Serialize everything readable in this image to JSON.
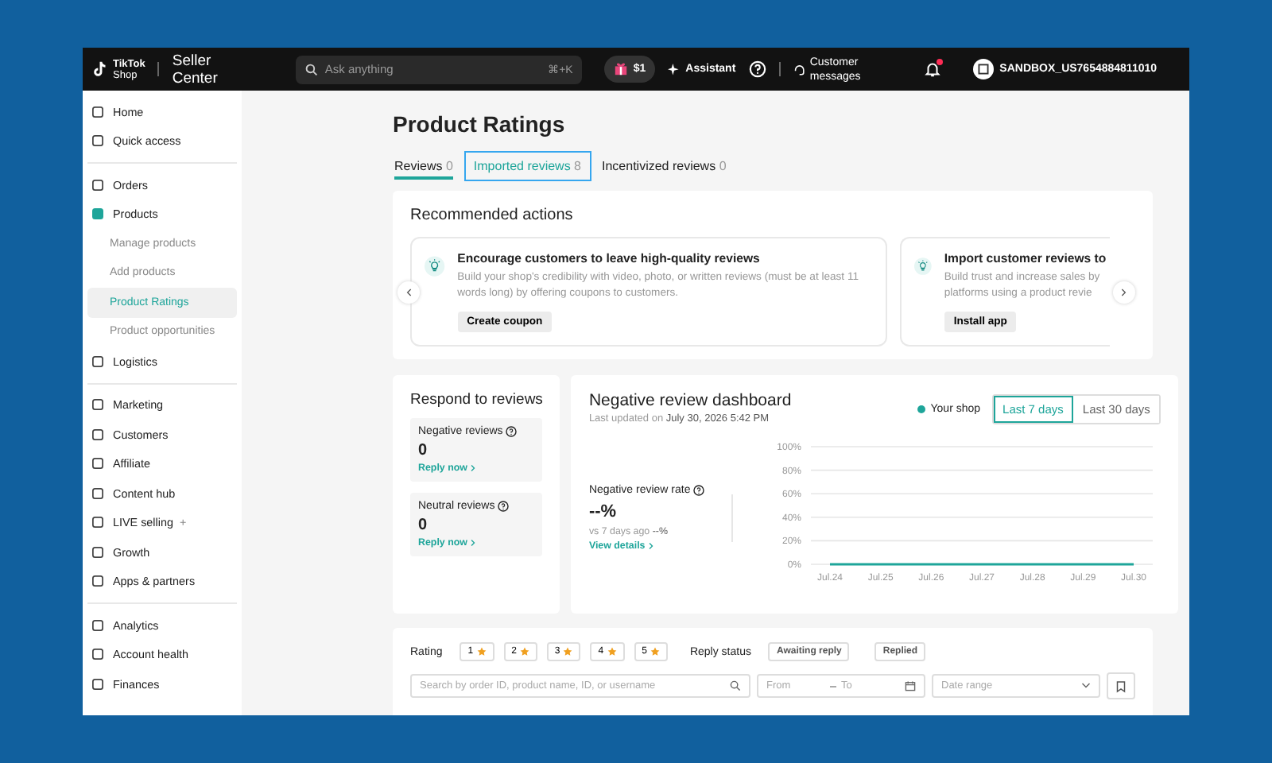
{
  "topbar": {
    "logo": "TikTok",
    "logo_sub": "Shop",
    "product": "Seller Center",
    "search": {
      "placeholder": "Ask anything",
      "shortcut": "⌘+K"
    },
    "gift": "$1",
    "assistant": "Assistant",
    "messages": "Customer messages",
    "notification_dot": true,
    "account": "SANDBOX_US7654884811010"
  },
  "sidebar": {
    "groups": [
      [
        {
          "label": "Home",
          "selected": false
        },
        {
          "label": "Quick access",
          "selected": false
        }
      ],
      [
        {
          "label": "Orders",
          "selected": false
        },
        {
          "label": "Products",
          "selected": false,
          "expanded": true,
          "children": [
            {
              "label": "Manage products",
              "selected": false
            },
            {
              "label": "Add products",
              "selected": false
            },
            {
              "label": "Product Ratings",
              "selected": true
            },
            {
              "label": "Product opportunities",
              "selected": false
            }
          ]
        },
        {
          "label": "Logistics",
          "selected": false
        }
      ],
      [
        {
          "label": "Marketing",
          "selected": false
        },
        {
          "label": "Customers",
          "selected": false
        },
        {
          "label": "Affiliate",
          "selected": false
        },
        {
          "label": "Content hub",
          "selected": false
        },
        {
          "label": "LIVE selling",
          "suffix": "+",
          "selected": false
        },
        {
          "label": "Growth",
          "selected": false
        },
        {
          "label": "Apps & partners",
          "selected": false
        }
      ],
      [
        {
          "label": "Analytics",
          "selected": false
        },
        {
          "label": "Account health",
          "selected": false
        },
        {
          "label": "Finances",
          "selected": false
        }
      ]
    ]
  },
  "page": {
    "title": "Product Ratings",
    "tabs": [
      {
        "label": "Reviews",
        "count": "0",
        "selected": true,
        "focused": false
      },
      {
        "label": "Imported reviews",
        "count": "8",
        "selected": false,
        "focused": true
      },
      {
        "label": "Incentivized reviews",
        "count": "0",
        "selected": false,
        "focused": false
      }
    ],
    "recommended": {
      "title": "Recommended actions",
      "actions": [
        {
          "title": "Encourage customers to leave high-quality reviews",
          "desc": "Build your shop's credibility with video, photo, or written reviews (must be at least 11 words long) by offering coupons to customers.",
          "button": "Create coupon"
        },
        {
          "title": "Import customer reviews to",
          "desc": "Build trust and increase sales by platforms using a product revie",
          "button": "Install app"
        }
      ]
    },
    "respond": {
      "title": "Respond to reviews",
      "items": [
        {
          "label": "Negative reviews",
          "value": "0",
          "link": "Reply now"
        },
        {
          "label": "Neutral reviews",
          "value": "0",
          "link": "Reply now"
        }
      ]
    },
    "dashboard": {
      "title": "Negative review dashboard",
      "updated_label": "Last updated on",
      "updated": "July 30, 2026 5:42 PM",
      "ranges": [
        {
          "label": "Last 7 days",
          "selected": true
        },
        {
          "label": "Last 30 days",
          "selected": false
        }
      ],
      "metric": {
        "label": "Negative review rate",
        "value": "--%",
        "compare_label": "vs 7 days ago",
        "compare": "--%",
        "link": "View details"
      },
      "chart_data": {
        "type": "line",
        "categories": [
          "Jul.24",
          "Jul.25",
          "Jul.26",
          "Jul.27",
          "Jul.28",
          "Jul.29",
          "Jul.30"
        ],
        "series": [
          {
            "name": "Your shop",
            "color": "#1ea59a",
            "values": [
              0,
              0,
              0,
              0,
              0,
              0,
              0
            ]
          }
        ],
        "grid": true,
        "ylim": [
          0,
          100
        ],
        "yticks": [
          {
            "value": 0,
            "label": "0%"
          },
          {
            "value": 20,
            "label": "20%"
          },
          {
            "value": 40,
            "label": "40%"
          },
          {
            "value": 60,
            "label": "60%"
          },
          {
            "value": 80,
            "label": "80%"
          },
          {
            "value": 100,
            "label": "100%"
          }
        ]
      }
    },
    "filters": {
      "rating_label": "Rating",
      "ratings": [
        {
          "label": "1",
          "selected": false
        },
        {
          "label": "2",
          "selected": false
        },
        {
          "label": "3",
          "selected": false
        },
        {
          "label": "4",
          "selected": false
        },
        {
          "label": "5",
          "selected": false
        }
      ],
      "status_label": "Reply status",
      "statuses": [
        {
          "label": "Awaiting reply",
          "selected": false
        },
        {
          "label": "Replied",
          "selected": false
        }
      ],
      "search": {
        "placeholder": "Search by order ID, product name, ID, or username"
      },
      "from": {
        "placeholder": "From"
      },
      "to": {
        "placeholder": "To"
      },
      "date_range": {
        "placeholder": "Date range"
      }
    }
  }
}
